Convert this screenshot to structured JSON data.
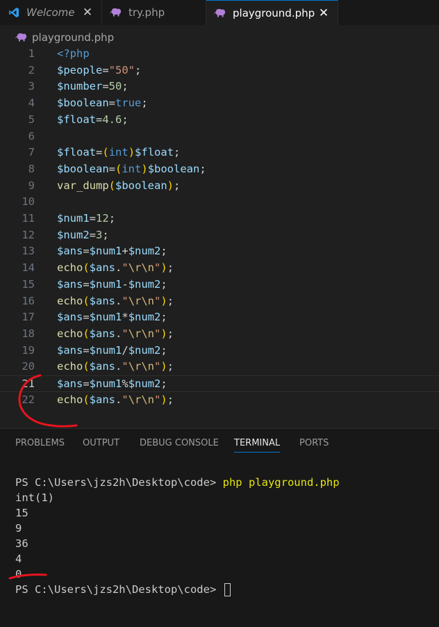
{
  "tabs": [
    {
      "label": "Welcome",
      "close": "✕"
    },
    {
      "label": "try.php"
    },
    {
      "label": "playground.php",
      "close": "✕"
    }
  ],
  "breadcrumb": {
    "file": "playground.php"
  },
  "editor": {
    "current_line": 21,
    "lines": [
      {
        "num": "1",
        "tokens": [
          [
            "k",
            "<?php"
          ]
        ]
      },
      {
        "num": "2",
        "tokens": [
          [
            "v",
            "$people"
          ],
          [
            "o",
            "="
          ],
          [
            "s",
            "\"50\""
          ],
          [
            "o",
            ";"
          ]
        ]
      },
      {
        "num": "3",
        "tokens": [
          [
            "v",
            "$number"
          ],
          [
            "o",
            "="
          ],
          [
            "n",
            "50"
          ],
          [
            "o",
            ";"
          ]
        ]
      },
      {
        "num": "4",
        "tokens": [
          [
            "v",
            "$boolean"
          ],
          [
            "o",
            "="
          ],
          [
            "k",
            "true"
          ],
          [
            "o",
            ";"
          ]
        ]
      },
      {
        "num": "5",
        "tokens": [
          [
            "v",
            "$float"
          ],
          [
            "o",
            "="
          ],
          [
            "n",
            "4.6"
          ],
          [
            "o",
            ";"
          ]
        ]
      },
      {
        "num": "6",
        "tokens": []
      },
      {
        "num": "7",
        "tokens": [
          [
            "v",
            "$float"
          ],
          [
            "o",
            "="
          ],
          [
            "p1",
            "("
          ],
          [
            "k",
            "int"
          ],
          [
            "p1",
            ")"
          ],
          [
            "v",
            "$float"
          ],
          [
            "o",
            ";"
          ]
        ]
      },
      {
        "num": "8",
        "tokens": [
          [
            "v",
            "$boolean"
          ],
          [
            "o",
            "="
          ],
          [
            "p1",
            "("
          ],
          [
            "k",
            "int"
          ],
          [
            "p1",
            ")"
          ],
          [
            "v",
            "$boolean"
          ],
          [
            "o",
            ";"
          ]
        ]
      },
      {
        "num": "9",
        "tokens": [
          [
            "f",
            "var_dump"
          ],
          [
            "p1",
            "("
          ],
          [
            "v",
            "$boolean"
          ],
          [
            "p1",
            ")"
          ],
          [
            "o",
            ";"
          ]
        ]
      },
      {
        "num": "10",
        "tokens": []
      },
      {
        "num": "11",
        "tokens": [
          [
            "v",
            "$num1"
          ],
          [
            "o",
            "="
          ],
          [
            "n",
            "12"
          ],
          [
            "o",
            ";"
          ]
        ]
      },
      {
        "num": "12",
        "tokens": [
          [
            "v",
            "$num2"
          ],
          [
            "o",
            "="
          ],
          [
            "n",
            "3"
          ],
          [
            "o",
            ";"
          ]
        ]
      },
      {
        "num": "13",
        "tokens": [
          [
            "v",
            "$ans"
          ],
          [
            "o",
            "="
          ],
          [
            "v",
            "$num1"
          ],
          [
            "o",
            "+"
          ],
          [
            "v",
            "$num2"
          ],
          [
            "o",
            ";"
          ]
        ]
      },
      {
        "num": "14",
        "tokens": [
          [
            "f",
            "echo"
          ],
          [
            "p1",
            "("
          ],
          [
            "v",
            "$ans"
          ],
          [
            "o",
            "."
          ],
          [
            "s",
            "\""
          ],
          [
            "e",
            "\\r\\n"
          ],
          [
            "s",
            "\""
          ],
          [
            "p1",
            ")"
          ],
          [
            "o",
            ";"
          ]
        ]
      },
      {
        "num": "15",
        "tokens": [
          [
            "v",
            "$ans"
          ],
          [
            "o",
            "="
          ],
          [
            "v",
            "$num1"
          ],
          [
            "o",
            "-"
          ],
          [
            "v",
            "$num2"
          ],
          [
            "o",
            ";"
          ]
        ]
      },
      {
        "num": "16",
        "tokens": [
          [
            "f",
            "echo"
          ],
          [
            "p1",
            "("
          ],
          [
            "v",
            "$ans"
          ],
          [
            "o",
            "."
          ],
          [
            "s",
            "\""
          ],
          [
            "e",
            "\\r\\n"
          ],
          [
            "s",
            "\""
          ],
          [
            "p1",
            ")"
          ],
          [
            "o",
            ";"
          ]
        ]
      },
      {
        "num": "17",
        "tokens": [
          [
            "v",
            "$ans"
          ],
          [
            "o",
            "="
          ],
          [
            "v",
            "$num1"
          ],
          [
            "o",
            "*"
          ],
          [
            "v",
            "$num2"
          ],
          [
            "o",
            ";"
          ]
        ]
      },
      {
        "num": "18",
        "tokens": [
          [
            "f",
            "echo"
          ],
          [
            "p1",
            "("
          ],
          [
            "v",
            "$ans"
          ],
          [
            "o",
            "."
          ],
          [
            "s",
            "\""
          ],
          [
            "e",
            "\\r\\n"
          ],
          [
            "s",
            "\""
          ],
          [
            "p1",
            ")"
          ],
          [
            "o",
            ";"
          ]
        ]
      },
      {
        "num": "19",
        "tokens": [
          [
            "v",
            "$ans"
          ],
          [
            "o",
            "="
          ],
          [
            "v",
            "$num1"
          ],
          [
            "o",
            "/"
          ],
          [
            "v",
            "$num2"
          ],
          [
            "o",
            ";"
          ]
        ]
      },
      {
        "num": "20",
        "tokens": [
          [
            "f",
            "echo"
          ],
          [
            "p1",
            "("
          ],
          [
            "v",
            "$ans"
          ],
          [
            "o",
            "."
          ],
          [
            "s",
            "\""
          ],
          [
            "e",
            "\\r\\n"
          ],
          [
            "s",
            "\""
          ],
          [
            "p1",
            ")"
          ],
          [
            "o",
            ";"
          ]
        ]
      },
      {
        "num": "21",
        "tokens": [
          [
            "v",
            "$ans"
          ],
          [
            "o",
            "="
          ],
          [
            "v",
            "$num1"
          ],
          [
            "o",
            "%"
          ],
          [
            "v",
            "$num2"
          ],
          [
            "o",
            ";"
          ]
        ]
      },
      {
        "num": "22",
        "tokens": [
          [
            "f",
            "echo"
          ],
          [
            "p1",
            "("
          ],
          [
            "v",
            "$ans"
          ],
          [
            "o",
            "."
          ],
          [
            "s",
            "\""
          ],
          [
            "e",
            "\\r\\n"
          ],
          [
            "s",
            "\""
          ],
          [
            "p1",
            ")"
          ],
          [
            "o",
            ";"
          ]
        ]
      }
    ]
  },
  "panel": {
    "tabs": [
      "PROBLEMS",
      "OUTPUT",
      "DEBUG CONSOLE",
      "TERMINAL",
      "PORTS"
    ],
    "active_tab": "TERMINAL"
  },
  "terminal": {
    "prompt": "PS C:\\Users\\jzs2h\\Desktop\\code> ",
    "command": "php playground.php",
    "output": [
      "int(1)",
      "15",
      "9",
      "36",
      "4",
      "0"
    ],
    "final_prompt": "PS C:\\Users\\jzs2h\\Desktop\\code> "
  },
  "colors": {
    "accent": "#0078d4",
    "annotation": "#e8141e",
    "php_icon": "#b180d7"
  }
}
